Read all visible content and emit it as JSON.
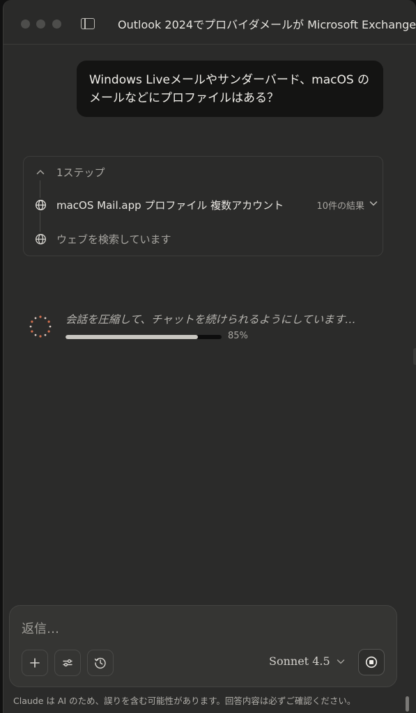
{
  "window": {
    "title": "Outlook 2024でプロバイダメールが Microsoft Exchange"
  },
  "conversation": {
    "user_message": "Windows Liveメールやサンダーバード、macOS のメールなどにプロファイルはある？"
  },
  "steps": {
    "header": "1ステップ",
    "items": [
      {
        "label": "macOS Mail.app プロファイル 複数アカウント",
        "count": "10件の結果",
        "icon": "globe-icon"
      },
      {
        "label": "ウェブを検索しています",
        "icon": "globe-icon"
      }
    ]
  },
  "compress": {
    "text": "会話を圧縮して、チャットを続けられるようにしています…",
    "progress": 85,
    "progress_label": "85%"
  },
  "composer": {
    "placeholder": "返信…",
    "model": "Sonnet 4.5"
  },
  "footer": {
    "disclaimer": "Claude は AI のため、誤りを含む可能性があります。回答内容は必ずご確認ください。"
  },
  "colors": {
    "spinner_accent": "#d4704e",
    "background": "#2b2b2a",
    "bubble": "#141413"
  }
}
